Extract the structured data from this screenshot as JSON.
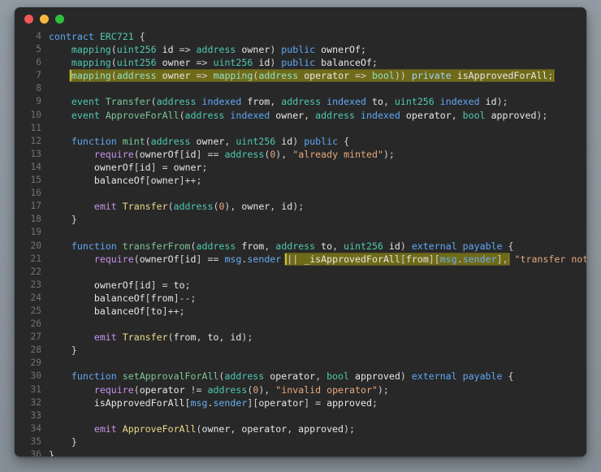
{
  "window": {
    "title": "",
    "traffic_lights": [
      {
        "name": "close",
        "color": "#f2575a"
      },
      {
        "name": "minimize",
        "color": "#f5b83d"
      },
      {
        "name": "maximize",
        "color": "#2fc040"
      }
    ],
    "background": "#282828",
    "desktop_background": "#8e98a0"
  },
  "editor": {
    "language": "solidity",
    "first_line_number": 4,
    "last_line_number": 36,
    "highlight_color": "#6f6a18",
    "highlight_border_color": "#c9bf3a",
    "line_numbers": [
      4,
      5,
      6,
      7,
      8,
      9,
      10,
      11,
      12,
      13,
      14,
      15,
      16,
      17,
      18,
      19,
      20,
      21,
      22,
      23,
      24,
      25,
      26,
      27,
      28,
      29,
      30,
      31,
      32,
      33,
      34,
      35,
      36
    ],
    "lines": [
      {
        "n": 4,
        "text": "contract ERC721 {"
      },
      {
        "n": 5,
        "text": "    mapping(uint256 id => address owner) public ownerOf;"
      },
      {
        "n": 6,
        "text": "    mapping(uint256 owner => uint256 id) public balanceOf;"
      },
      {
        "n": 7,
        "text": "    mapping(address owner => mapping(address operator => bool)) private isApprovedForAll;",
        "highlighted": true
      },
      {
        "n": 8,
        "text": ""
      },
      {
        "n": 9,
        "text": "    event Transfer(address indexed from, address indexed to, uint256 indexed id);"
      },
      {
        "n": 10,
        "text": "    event ApproveForAll(address indexed owner, address indexed operator, bool approved);"
      },
      {
        "n": 11,
        "text": ""
      },
      {
        "n": 12,
        "text": "    function mint(address owner, uint256 id) public {"
      },
      {
        "n": 13,
        "text": "        require(ownerOf[id] == address(0), \"already minted\");"
      },
      {
        "n": 14,
        "text": "        ownerOf[id] = owner;"
      },
      {
        "n": 15,
        "text": "        balanceOf[owner]++;"
      },
      {
        "n": 16,
        "text": ""
      },
      {
        "n": 17,
        "text": "        emit Transfer(address(0), owner, id);"
      },
      {
        "n": 18,
        "text": "    }"
      },
      {
        "n": 19,
        "text": ""
      },
      {
        "n": 20,
        "text": "    function transferFrom(address from, address to, uint256 id) external payable {"
      },
      {
        "n": 21,
        "text": "        require(ownerOf[id] == msg.sender || _isApprovedForAll[from][msg.sender], \"transfer not allowed\");",
        "partial_highlight": "|| _isApprovedForAll[from][msg.sender],"
      },
      {
        "n": 22,
        "text": ""
      },
      {
        "n": 23,
        "text": "        ownerOf[id] = to;"
      },
      {
        "n": 24,
        "text": "        balanceOf[from]--;"
      },
      {
        "n": 25,
        "text": "        balanceOf[to]++;"
      },
      {
        "n": 26,
        "text": ""
      },
      {
        "n": 27,
        "text": "        emit Transfer(from, to, id);"
      },
      {
        "n": 28,
        "text": "    }"
      },
      {
        "n": 29,
        "text": ""
      },
      {
        "n": 30,
        "text": "    function setApprovalForAll(address operator, bool approved) external payable {"
      },
      {
        "n": 31,
        "text": "        require(operator != address(0), \"invalid operator\");"
      },
      {
        "n": 32,
        "text": "        isApprovedForAll[msg.sender][operator] = approved;"
      },
      {
        "n": 33,
        "text": ""
      },
      {
        "n": 34,
        "text": "        emit ApproveForAll(owner, operator, approved);"
      },
      {
        "n": 35,
        "text": "    }"
      },
      {
        "n": 36,
        "text": "}"
      }
    ],
    "colors": {
      "keyword": "#5fa8f5",
      "type": "#4ec9b0",
      "identifier_green": "#7ec699",
      "function_call": "#e8d98a",
      "statement_keyword": "#c792ea",
      "string": "#e8a87c",
      "number": "#e8a87c",
      "plain": "#e6e6e6",
      "member": "#6aaef0",
      "line_number": "#6f7276"
    }
  }
}
